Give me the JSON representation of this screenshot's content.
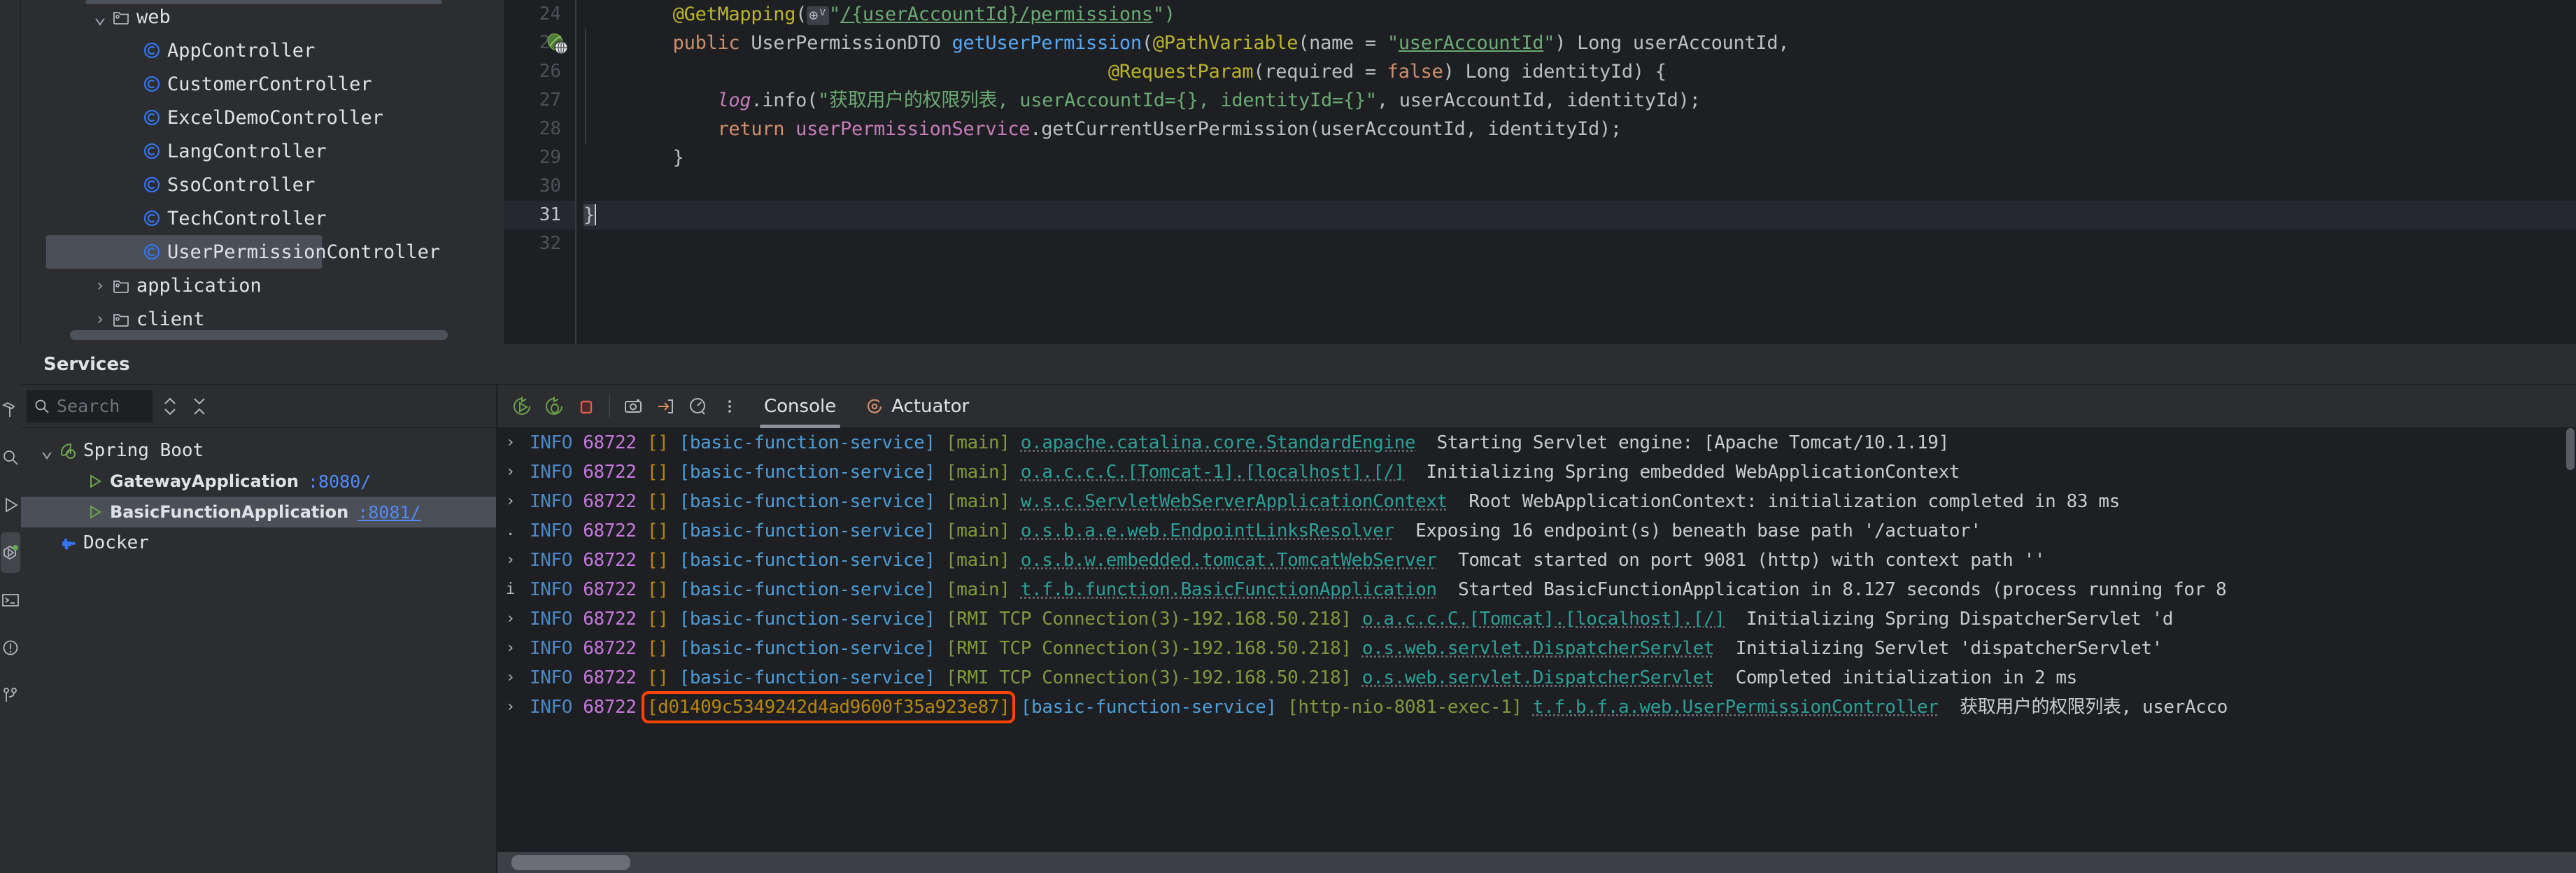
{
  "project_tree": {
    "items": [
      {
        "indent": 4,
        "arrow": "v",
        "icon": "folder-icon",
        "label": "web",
        "selected": false
      },
      {
        "indent": 6,
        "arrow": "",
        "icon": "class-icon",
        "label": "AppController",
        "selected": false
      },
      {
        "indent": 6,
        "arrow": "",
        "icon": "class-icon",
        "label": "CustomerController",
        "selected": false
      },
      {
        "indent": 6,
        "arrow": "",
        "icon": "class-icon",
        "label": "ExcelDemoController",
        "selected": false
      },
      {
        "indent": 6,
        "arrow": "",
        "icon": "class-icon",
        "label": "LangController",
        "selected": false
      },
      {
        "indent": 6,
        "arrow": "",
        "icon": "class-icon",
        "label": "SsoController",
        "selected": false
      },
      {
        "indent": 6,
        "arrow": "",
        "icon": "class-icon",
        "label": "TechController",
        "selected": false
      },
      {
        "indent": 6,
        "arrow": "",
        "icon": "class-icon",
        "label": "UserPermissionController",
        "selected": true
      },
      {
        "indent": 4,
        "arrow": ">",
        "icon": "folder-icon",
        "label": "application",
        "selected": false
      },
      {
        "indent": 4,
        "arrow": ">",
        "icon": "folder-icon",
        "label": "client",
        "selected": false
      }
    ]
  },
  "editor": {
    "line_numbers": [
      "24",
      "25",
      "26",
      "27",
      "28",
      "29",
      "30",
      "31",
      "32"
    ],
    "current_line": "31",
    "gutter_marker_line": "25",
    "gutter_marker_icon": "spring-web-endpoint-icon",
    "lines": [
      {
        "n": "24",
        "tokens": [
          {
            "t": "        ",
            "c": "s-plain"
          },
          {
            "t": "@GetMapping",
            "c": "s-anno"
          },
          {
            "t": "(",
            "c": "s-plain"
          },
          {
            "t": "⊕ⱽ",
            "c": "inline-hint"
          },
          {
            "t": "\"",
            "c": "s-str"
          },
          {
            "t": "/{userAccountId}/permissions",
            "c": "s-strlink"
          },
          {
            "t": "\")",
            "c": "s-str"
          }
        ]
      },
      {
        "n": "25",
        "tokens": [
          {
            "t": "        ",
            "c": "s-plain"
          },
          {
            "t": "public ",
            "c": "s-kw"
          },
          {
            "t": "UserPermissionDTO ",
            "c": "s-type"
          },
          {
            "t": "getUserPermission",
            "c": "s-meth"
          },
          {
            "t": "(",
            "c": "s-plain"
          },
          {
            "t": "@PathVariable",
            "c": "s-anno"
          },
          {
            "t": "(name = ",
            "c": "s-plain"
          },
          {
            "t": "\"",
            "c": "s-str"
          },
          {
            "t": "userAccountId",
            "c": "s-strlink"
          },
          {
            "t": "\"",
            "c": "s-str"
          },
          {
            "t": ") Long userAccountId,",
            "c": "s-plain"
          }
        ]
      },
      {
        "n": "26",
        "tokens": [
          {
            "t": "                                               ",
            "c": "s-plain"
          },
          {
            "t": "@RequestParam",
            "c": "s-anno"
          },
          {
            "t": "(required = ",
            "c": "s-plain"
          },
          {
            "t": "false",
            "c": "s-kw"
          },
          {
            "t": ") Long identityId) {",
            "c": "s-plain"
          }
        ]
      },
      {
        "n": "27",
        "tokens": [
          {
            "t": "            ",
            "c": "s-plain"
          },
          {
            "t": "log",
            "c": "s-field"
          },
          {
            "t": ".info(",
            "c": "s-plain"
          },
          {
            "t": "\"获取用户的权限列表, userAccountId={}, identityId={}\"",
            "c": "s-str"
          },
          {
            "t": ", userAccountId, identityId);",
            "c": "s-plain"
          }
        ]
      },
      {
        "n": "28",
        "tokens": [
          {
            "t": "            ",
            "c": "s-plain"
          },
          {
            "t": "return ",
            "c": "s-kw"
          },
          {
            "t": "userPermissionService",
            "c": "s-var"
          },
          {
            "t": ".getCurrentUserPermission(userAccountId, identityId);",
            "c": "s-plain"
          }
        ]
      },
      {
        "n": "29",
        "tokens": [
          {
            "t": "        }",
            "c": "s-plain"
          }
        ]
      },
      {
        "n": "30",
        "tokens": []
      },
      {
        "n": "31",
        "tokens": [
          {
            "t": "}",
            "c": "s-plain brace-hl"
          }
        ]
      },
      {
        "n": "32",
        "tokens": []
      }
    ]
  },
  "services_header": {
    "title": "Services"
  },
  "left_rail": {
    "items": [
      {
        "name": "build-icon",
        "label": "Build",
        "active": false
      },
      {
        "name": "search-icon",
        "label": "Search Everywhere",
        "active": false
      },
      {
        "name": "run-icon",
        "label": "Run",
        "active": false
      },
      {
        "name": "services-icon",
        "label": "Services",
        "active": true
      },
      {
        "name": "terminal-icon",
        "label": "Terminal",
        "active": false
      },
      {
        "name": "problems-icon",
        "label": "Problems",
        "active": false
      },
      {
        "name": "git-branch-icon",
        "label": "Version Control",
        "active": false
      }
    ]
  },
  "services_panel": {
    "search_placeholder": "Search",
    "toolbar_icons": [
      "expand-collapse-icon",
      "collapse-all-icon"
    ],
    "tree": [
      {
        "indent": 0,
        "arrow": "v",
        "icon": "spring-boot-icon",
        "label": "Spring Boot",
        "port": "",
        "bold": false,
        "selected": false
      },
      {
        "indent": 1,
        "arrow": "",
        "icon": "run-green-icon",
        "label": "GatewayApplication",
        "port": ":8080/",
        "bold": true,
        "selected": false
      },
      {
        "indent": 1,
        "arrow": "",
        "icon": "run-green-icon",
        "label": "BasicFunctionApplication",
        "port": ":8081/",
        "bold": true,
        "selected": true
      },
      {
        "indent": 0,
        "arrow": "",
        "icon": "docker-icon",
        "label": "Docker",
        "port": "",
        "bold": false,
        "selected": false
      }
    ]
  },
  "console": {
    "toolbar_icons": [
      "rerun-icon",
      "rerun-debug-icon",
      "stop-icon",
      "camera-icon",
      "export-icon",
      "gauge-icon",
      "more-vertical-icon"
    ],
    "tabs": [
      {
        "label": "Console",
        "icon": "",
        "active": true
      },
      {
        "label": "Actuator",
        "icon": "actuator-icon",
        "active": false
      }
    ],
    "highlight_color": "#ff4500",
    "highlighted_trace_id": "d01409c5349242d4ad9600f35a923e87",
    "lines": [
      {
        "fold": "›",
        "level": "INFO",
        "pid": "68722",
        "trace": "[]",
        "service": "[basic-function-service]",
        "thread": "[main]",
        "logger": "o.apache.catalina.core.StandardEngine",
        "message": "Starting Servlet engine: [Apache Tomcat/10.1.19]",
        "highlight": false
      },
      {
        "fold": "›",
        "level": "INFO",
        "pid": "68722",
        "trace": "[]",
        "service": "[basic-function-service]",
        "thread": "[main]",
        "logger": "o.a.c.c.C.[Tomcat-1].[localhost].[/]",
        "message": "Initializing Spring embedded WebApplicationContext",
        "highlight": false
      },
      {
        "fold": "›",
        "level": "INFO",
        "pid": "68722",
        "trace": "[]",
        "service": "[basic-function-service]",
        "thread": "[main]",
        "logger": "w.s.c.ServletWebServerApplicationContext",
        "message": "Root WebApplicationContext: initialization completed in 83 ms",
        "highlight": false
      },
      {
        "fold": ".",
        "level": "INFO",
        "pid": "68722",
        "trace": "[]",
        "service": "[basic-function-service]",
        "thread": "[main]",
        "logger": "o.s.b.a.e.web.EndpointLinksResolver",
        "message": "Exposing 16 endpoint(s) beneath base path '/actuator'",
        "highlight": false
      },
      {
        "fold": "›",
        "level": "INFO",
        "pid": "68722",
        "trace": "[]",
        "service": "[basic-function-service]",
        "thread": "[main]",
        "logger": "o.s.b.w.embedded.tomcat.TomcatWebServer",
        "message": "Tomcat started on port 9081 (http) with context path ''",
        "highlight": false
      },
      {
        "fold": "i",
        "level": "INFO",
        "pid": "68722",
        "trace": "[]",
        "service": "[basic-function-service]",
        "thread": "[main]",
        "logger": "t.f.b.function.BasicFunctionApplication",
        "message": "Started BasicFunctionApplication in 8.127 seconds (process running for 8",
        "highlight": false
      },
      {
        "fold": "›",
        "level": "INFO",
        "pid": "68722",
        "trace": "[]",
        "service": "[basic-function-service]",
        "thread": "[RMI TCP Connection(3)-192.168.50.218]",
        "logger": "o.a.c.c.C.[Tomcat].[localhost].[/]",
        "message": "Initializing Spring DispatcherServlet 'd",
        "highlight": false
      },
      {
        "fold": "›",
        "level": "INFO",
        "pid": "68722",
        "trace": "[]",
        "service": "[basic-function-service]",
        "thread": "[RMI TCP Connection(3)-192.168.50.218]",
        "logger": "o.s.web.servlet.DispatcherServlet",
        "message": "Initializing Servlet 'dispatcherServlet'",
        "highlight": false
      },
      {
        "fold": "›",
        "level": "INFO",
        "pid": "68722",
        "trace": "[]",
        "service": "[basic-function-service]",
        "thread": "[RMI TCP Connection(3)-192.168.50.218]",
        "logger": "o.s.web.servlet.DispatcherServlet",
        "message": "Completed initialization in 2 ms",
        "highlight": false
      },
      {
        "fold": "›",
        "level": "INFO",
        "pid": "68722",
        "trace": "[d01409c5349242d4ad9600f35a923e87]",
        "service": "[basic-function-service]",
        "thread": "[http-nio-8081-exec-1]",
        "logger": "t.f.b.f.a.web.UserPermissionController",
        "message": "获取用户的权限列表, userAcco",
        "highlight": true
      }
    ]
  }
}
